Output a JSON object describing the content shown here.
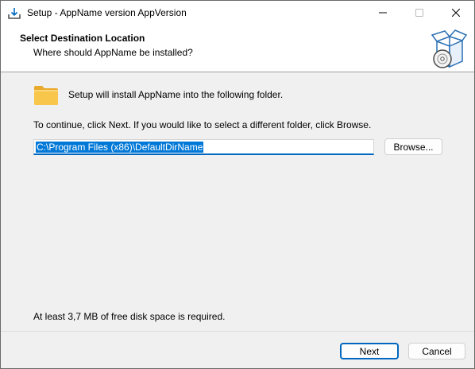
{
  "window": {
    "title": "Setup - AppName version AppVersion",
    "icons": {
      "app": "setup-install-icon",
      "minimize": "minimize-icon",
      "maximize": "maximize-icon",
      "close": "close-icon"
    }
  },
  "header": {
    "title": "Select Destination Location",
    "subtitle": "Where should AppName be installed?",
    "icon": "software-box-disc-icon"
  },
  "body": {
    "folder_icon": "folder-icon",
    "intro": "Setup will install AppName into the following folder.",
    "instruction": "To continue, click Next. If you would like to select a different folder, click Browse.",
    "path_value": "C:\\Program Files (x86)\\DefaultDirName",
    "browse_label": "Browse...",
    "disk_space": "At least 3,7 MB of free disk space is required."
  },
  "footer": {
    "next_label": "Next",
    "cancel_label": "Cancel"
  },
  "colors": {
    "accent": "#0067c0",
    "selection": "#0078d7",
    "folder": "#f6c342",
    "background": "#f0f0f0"
  }
}
